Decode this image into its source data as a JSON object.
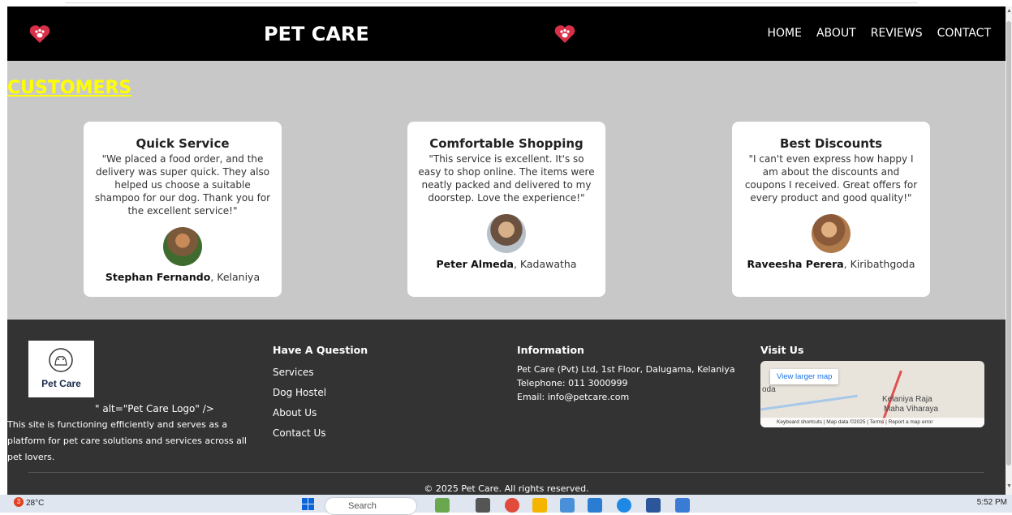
{
  "header": {
    "brand": "PET CARE",
    "nav": [
      "HOME",
      "ABOUT",
      "REVIEWS",
      "CONTACT"
    ]
  },
  "section_title": "CUSTOMERS",
  "cards": [
    {
      "title": "Quick Service",
      "quote": "\"We placed a food order, and the delivery was super quick. They also helped us choose a suitable shampoo for our dog. Thank you for the excellent service!\"",
      "name": "Stephan Fernando",
      "location": ", Kelaniya"
    },
    {
      "title": "Comfortable Shopping",
      "quote": "\"This service is excellent. It's so easy to shop online. The items were neatly packed and delivered to my doorstep. Love the experience!\"",
      "name": "Peter Almeda",
      "location": ", Kadawatha"
    },
    {
      "title": "Best Discounts",
      "quote": "\"I can't even express how happy I am about the discounts and coupons I received. Great offers for every product and good quality!\"",
      "name": "Raveesha Perera",
      "location": ", Kiribathgoda"
    }
  ],
  "footer": {
    "logo_text": "Pet Care",
    "alt_text": "\" alt=\"Pet Care Logo\" />",
    "about": "This site is functioning efficiently and serves as a platform for pet care solutions and services across all pet lovers.",
    "col2": {
      "heading": "Have A Question",
      "links": [
        "Services",
        "Dog Hostel",
        "About Us",
        "Contact Us"
      ]
    },
    "col3": {
      "heading": "Information",
      "lines": [
        "Pet Care (Pvt) Ltd, 1st Floor, Dalugama, Kelaniya",
        "Telephone: 011 3000999",
        "Email: info@petcare.com"
      ]
    },
    "col4": {
      "heading": "Visit Us",
      "map_button": "View larger map",
      "map_labels": [
        "Kelaniya Raja",
        "Maha Viharaya",
        "oda"
      ],
      "map_attribution": "Keyboard shortcuts | Map data ©2025 | Terms | Report a map error"
    },
    "copyright": "© 2025 Pet Care. All rights reserved."
  },
  "taskbar": {
    "weather": "28°C",
    "weather_badge": "3",
    "search_placeholder": "Search",
    "time": "5:52 PM"
  },
  "colors": {
    "header_bg": "#000000",
    "page_bg": "#c8c8c8",
    "title_color": "#ffff00",
    "footer_bg": "#333333",
    "heart_red": "#d9304a"
  }
}
